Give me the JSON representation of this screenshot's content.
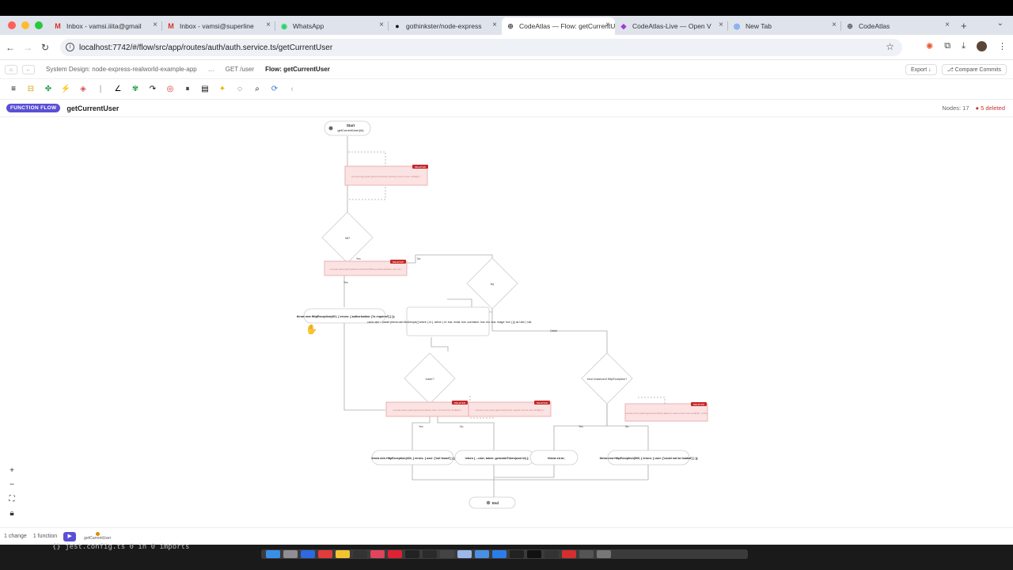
{
  "browser": {
    "tabs": [
      {
        "icon": "gmail-icon",
        "title": "Inbox - vamsi.iiita@gmail"
      },
      {
        "icon": "gmail-icon",
        "title": "Inbox - vamsi@superline"
      },
      {
        "icon": "whatsapp-icon",
        "title": "WhatsApp"
      },
      {
        "icon": "github-icon",
        "title": "gothinkster/node-express"
      },
      {
        "icon": "globe-icon",
        "title": "CodeAtlas — Flow: getCurrentUser"
      },
      {
        "icon": "codeatlas-icon",
        "title": "CodeAtlas-Live — Open V"
      },
      {
        "icon": "chrome-icon",
        "title": "New Tab"
      },
      {
        "icon": "globe-icon",
        "title": "CodeAtlas"
      }
    ],
    "url": "localhost:7742/#/flow/src/app/routes/auth/auth.service.ts/getCurrentUser"
  },
  "breadcrumbs": {
    "items": [
      "System Design: node-express-realworld-example-app",
      "…",
      "GET /user",
      "Flow: getCurrentUser"
    ],
    "export_label": "Export ↓",
    "compare_label": "⎇ Compare Commits"
  },
  "header": {
    "badge": "FUNCTION FLOW",
    "function_name": "getCurrentUser",
    "nodes": "Nodes: 17",
    "deleted": "● 5 deleted"
  },
  "flow": {
    "start_label": "Start",
    "start_sub": "getCurrentUser(id)",
    "deleted_tag": "DELETED",
    "deleted_1": "console.log(`[auth.getCurrentUser] fetching current user id=${id}`);",
    "cond_1": "!id?",
    "deleted_2": "console.warn('[auth.getCurrentUser] Missing authentication user id');",
    "yes": "Yes",
    "no": "No",
    "throw_401": "throw new HttpException(401, { errors: { authorization: ['is required'] } });",
    "try": "try",
    "const_user": "const user = (await prisma.user.findUnique({ where: { id }, select: { id: true, email: true, username: true, bio: true, image: true } })) as User | null;",
    "catch": "Catch",
    "cond_user": "!user?",
    "cond_err": "error instanceof HttpException?",
    "deleted_3": "console.warn(`[auth.getCurrentUser] User not found for id=${id}`);",
    "deleted_4": "console.info(`[auth.getCurrentUser] loaded current user id=${id}`);",
    "deleted_5": "console.error(`[auth.getCurrentUser] failed to load current user id=${id}`, error);",
    "throw_404": "throw new HttpException(404, { errors: { user: ['not found'] } });",
    "return_user": "return { ...user, token: generateToken(user.id) };",
    "throw_error": "throw error;",
    "throw_500": "throw new HttpException(500, { errors: { user: ['could not be loaded'] } });",
    "end_label": "End"
  },
  "footer": {
    "changes": "1 change",
    "functions": "1 function",
    "node_label": "getCurrentUser"
  },
  "terminal_text": "{} jest.config.ts  0 in  0 imports"
}
